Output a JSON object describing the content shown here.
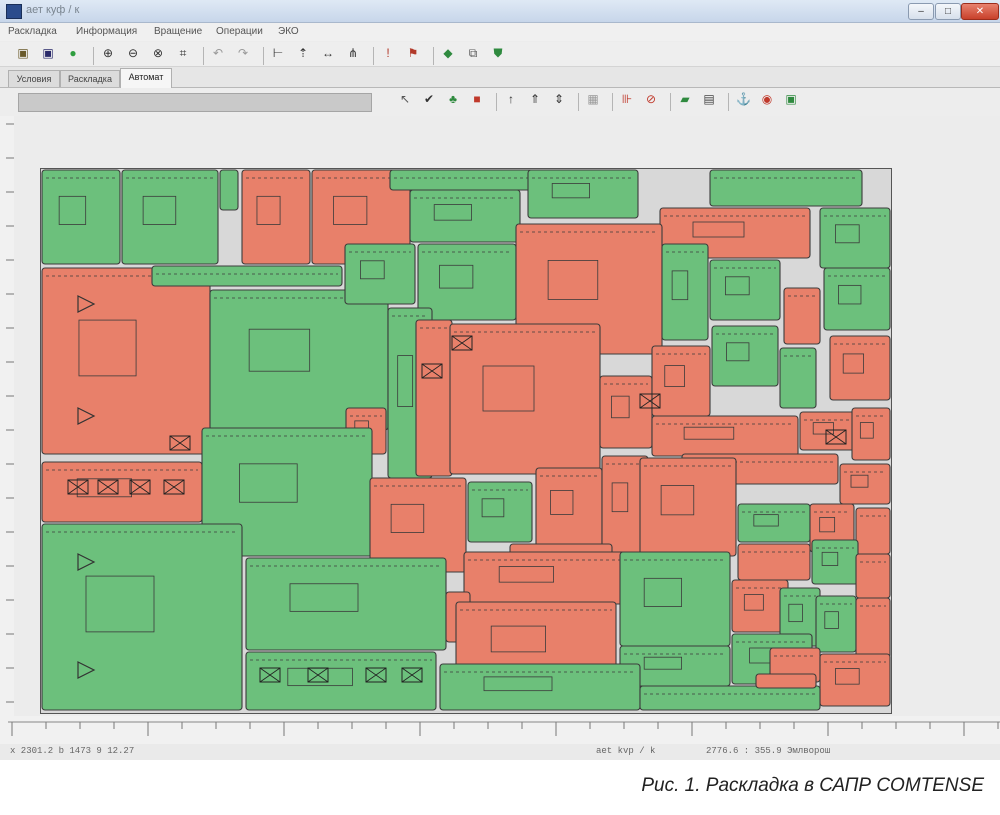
{
  "window": {
    "title": "ает куф / к",
    "controls": {
      "minimize": "–",
      "maximize": "□",
      "close": "✕"
    }
  },
  "menu": [
    {
      "label": "Раскладка"
    },
    {
      "label": "Информация"
    },
    {
      "label": "Вращение"
    },
    {
      "label": "Операции"
    },
    {
      "label": "ЭКО"
    }
  ],
  "toolbar_main": [
    {
      "name": "open-icon",
      "glyph": "▣",
      "color": "#6a5a2a"
    },
    {
      "name": "save-icon",
      "glyph": "▣",
      "color": "#2a2a6a"
    },
    {
      "name": "record-icon",
      "glyph": "●",
      "color": "#2f9e3f"
    },
    {
      "name": "zoom-in-icon",
      "glyph": "⊕",
      "color": "#333333"
    },
    {
      "name": "zoom-out-icon",
      "glyph": "⊖",
      "color": "#333333"
    },
    {
      "name": "zoom-window-icon",
      "glyph": "⊗",
      "color": "#333333"
    },
    {
      "name": "zoom-all-icon",
      "glyph": "⌗",
      "color": "#333333"
    },
    {
      "name": "undo-icon",
      "glyph": "↶",
      "color": "#999999"
    },
    {
      "name": "redo-icon",
      "glyph": "↷",
      "color": "#999999"
    },
    {
      "name": "align-icon",
      "glyph": "⊢",
      "color": "#333333"
    },
    {
      "name": "move-up-icon",
      "glyph": "⇡",
      "color": "#333333"
    },
    {
      "name": "move-horizontal-icon",
      "glyph": "↔",
      "color": "#333333"
    },
    {
      "name": "tree-icon",
      "glyph": "⋔",
      "color": "#333333"
    },
    {
      "name": "marker-icon",
      "glyph": "!",
      "color": "#b23a2a"
    },
    {
      "name": "flag-icon",
      "glyph": "⚑",
      "color": "#b23a2a"
    },
    {
      "name": "layers-icon",
      "glyph": "◆",
      "color": "#2f8a3f"
    },
    {
      "name": "copy-icon",
      "glyph": "⧉",
      "color": "#555555"
    },
    {
      "name": "shield-icon",
      "glyph": "⛊",
      "color": "#2f8a3f"
    }
  ],
  "tabs": [
    {
      "label": "Условия",
      "active": false
    },
    {
      "label": "Раскладка",
      "active": false
    },
    {
      "label": "Автомат",
      "active": true
    }
  ],
  "toolbar_auto": [
    {
      "name": "cursor-icon",
      "glyph": "↖",
      "color": "#555555"
    },
    {
      "name": "check-icon",
      "glyph": "✔",
      "color": "#333333"
    },
    {
      "name": "tree-green-icon",
      "glyph": "♣",
      "color": "#2f8a3f"
    },
    {
      "name": "piece-red-icon",
      "glyph": "■",
      "color": "#c0392b"
    },
    {
      "name": "arrow-up-icon",
      "glyph": "↑",
      "color": "#333333"
    },
    {
      "name": "arrow-up-double-icon",
      "glyph": "⇑",
      "color": "#333333"
    },
    {
      "name": "arrow-updown-icon",
      "glyph": "⇕",
      "color": "#333333"
    },
    {
      "name": "grid-icon",
      "glyph": "▦",
      "color": "#999999"
    },
    {
      "name": "ruler-icon",
      "glyph": "⊪",
      "color": "#c0392b"
    },
    {
      "name": "stop-icon",
      "glyph": "⊘",
      "color": "#c0392b"
    },
    {
      "name": "folder-icon",
      "glyph": "▰",
      "color": "#2f8a3f"
    },
    {
      "name": "print-icon",
      "glyph": "▤",
      "color": "#444444"
    },
    {
      "name": "anchor-icon",
      "glyph": "⚓",
      "color": "#444444"
    },
    {
      "name": "record-stop-icon",
      "glyph": "◉",
      "color": "#c0392b"
    },
    {
      "name": "lock-icon",
      "glyph": "▣",
      "color": "#2f8a3f"
    }
  ],
  "status": {
    "coords": "x 2301.2   b 1473   9 12.27",
    "file": "aet kvp / k",
    "position": "2776.6 : 355.9 Эмлворош"
  },
  "layout_colors": {
    "pieceA": "#e8806a",
    "pieceB": "#6cc07c",
    "outline": "#3b3b3b",
    "sheet": "#d8d8d8"
  },
  "caption": "Рис. 1. Раскладка в САПР COMTENSE"
}
